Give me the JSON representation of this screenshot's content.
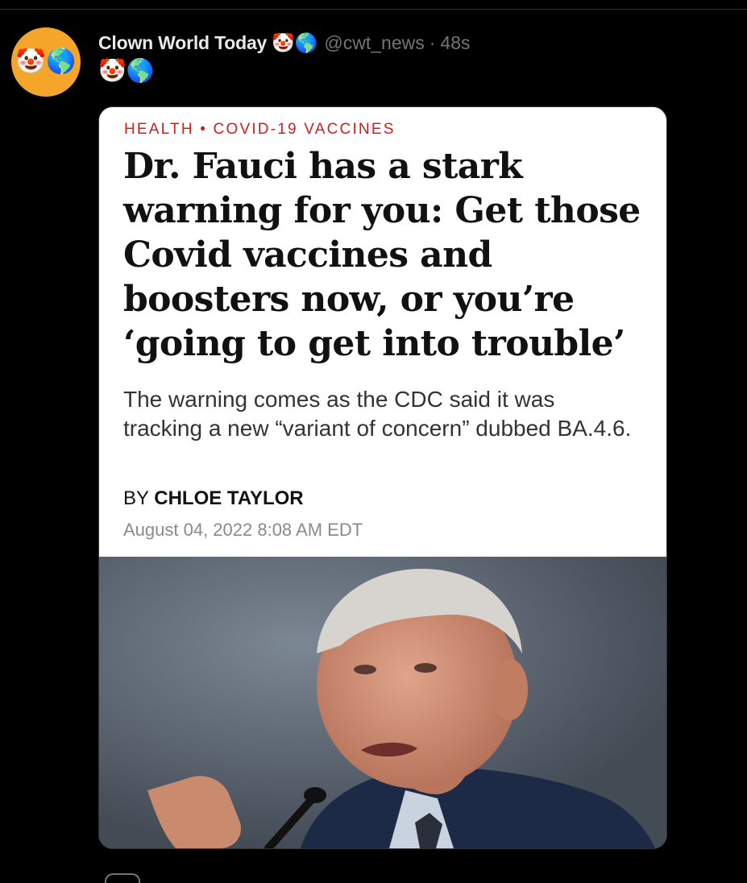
{
  "tweet": {
    "avatar_emoji": "🤡🌎",
    "display_name": "Clown World Today",
    "name_emoji": "🤡🌎",
    "handle": "@cwt_news",
    "separator": "·",
    "time": "48s",
    "text": "🤡🌎"
  },
  "card": {
    "kicker": "HEALTH • COVID-19 VACCINES",
    "headline": "Dr. Fauci has a stark warning for you: Get those Covid vaccines and boosters now, or you’re ‘going to get into trouble’",
    "dek": "The warning comes as the CDC said it was tracking a new “variant of concern” dubbed BA.4.6.",
    "byline_prefix": "BY",
    "byline_author": "CHLOE TAYLOR",
    "date": "August 04, 2022 8:08 AM EDT"
  },
  "colors": {
    "kicker": "#d11d1d",
    "avatar_bg": "#f5a52a",
    "background": "#000000"
  }
}
